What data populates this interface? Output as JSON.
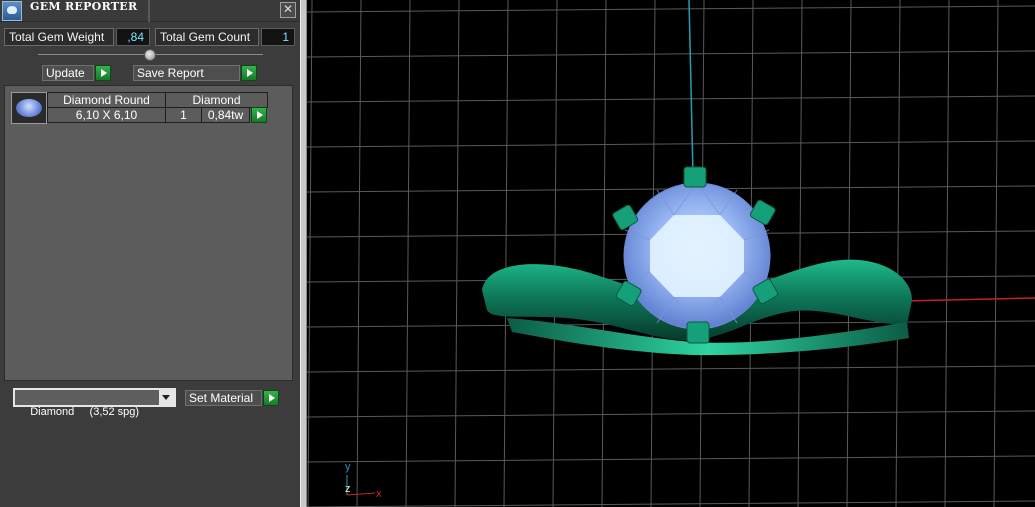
{
  "window": {
    "title": "GEM REPORTER",
    "close_glyph": "✕"
  },
  "totals": {
    "weight_label": "Total Gem Weight",
    "weight_value": ",84",
    "count_label": "Total Gem Count",
    "count_value": "1"
  },
  "buttons": {
    "update_label": "Update",
    "save_report_label": "Save Report",
    "set_material_label": "Set Material"
  },
  "gem_list": {
    "headers": [
      "Diamond Round",
      "Diamond"
    ],
    "rows": [
      {
        "size": "6,10 X 6,10",
        "qty": "1",
        "weight": "0,84tw"
      }
    ]
  },
  "material_select": {
    "selected": "Diamond     (3,52 spg)"
  },
  "viewport": {
    "axis_y_label": "y",
    "axis_z_label": "z",
    "axis_x_label": "x",
    "colors": {
      "grid": "#5a5a5a",
      "metal": "#0f8a66",
      "stone": "#8fb0f0",
      "x_axis": "#c8241c",
      "y_axis": "#2a9ab0"
    }
  },
  "icons": [
    "gem-reporter-app-icon",
    "close-icon",
    "slider-thumb-icon",
    "play-arrow-icon",
    "gem-thumbnail-icon",
    "dropdown-arrow-icon"
  ]
}
